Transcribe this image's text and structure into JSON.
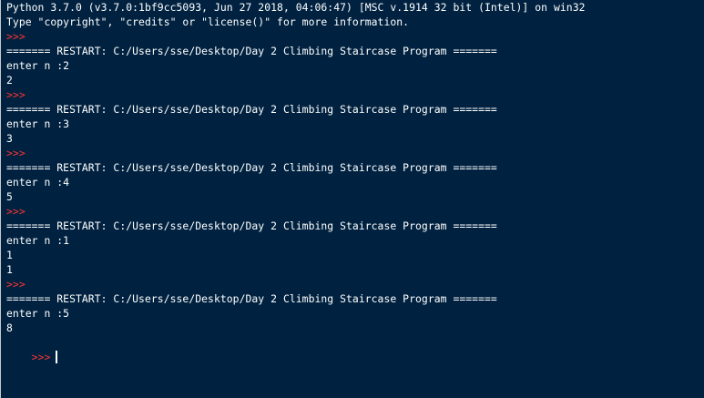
{
  "colors": {
    "background": "#002240",
    "text": "#ffffff",
    "prompt": "#ff3333"
  },
  "shell": {
    "lines": [
      {
        "kind": "banner",
        "text": "Python 3.7.0 (v3.7.0:1bf9cc5093, Jun 27 2018, 04:06:47) [MSC v.1914 32 bit (Intel)] on win32"
      },
      {
        "kind": "banner",
        "text": "Type \"copyright\", \"credits\" or \"license()\" for more information."
      },
      {
        "kind": "prompt",
        "text": ">>> "
      },
      {
        "kind": "restart",
        "text": "======= RESTART: C:/Users/sse/Desktop/Day 2 Climbing Staircase Program ======="
      },
      {
        "kind": "input",
        "text": "enter n :2"
      },
      {
        "kind": "output",
        "text": "2"
      },
      {
        "kind": "prompt",
        "text": ">>> "
      },
      {
        "kind": "restart",
        "text": "======= RESTART: C:/Users/sse/Desktop/Day 2 Climbing Staircase Program ======="
      },
      {
        "kind": "input",
        "text": "enter n :3"
      },
      {
        "kind": "output",
        "text": "3"
      },
      {
        "kind": "prompt",
        "text": ">>> "
      },
      {
        "kind": "restart",
        "text": "======= RESTART: C:/Users/sse/Desktop/Day 2 Climbing Staircase Program ======="
      },
      {
        "kind": "input",
        "text": "enter n :4"
      },
      {
        "kind": "output",
        "text": "5"
      },
      {
        "kind": "prompt",
        "text": ">>> "
      },
      {
        "kind": "restart",
        "text": "======= RESTART: C:/Users/sse/Desktop/Day 2 Climbing Staircase Program ======="
      },
      {
        "kind": "input",
        "text": "enter n :1"
      },
      {
        "kind": "output",
        "text": "1"
      },
      {
        "kind": "output",
        "text": "1"
      },
      {
        "kind": "prompt",
        "text": ">>> "
      },
      {
        "kind": "restart",
        "text": "======= RESTART: C:/Users/sse/Desktop/Day 2 Climbing Staircase Program ======="
      },
      {
        "kind": "input",
        "text": "enter n :5"
      },
      {
        "kind": "output",
        "text": "8"
      }
    ],
    "active_prompt": ">>>"
  }
}
